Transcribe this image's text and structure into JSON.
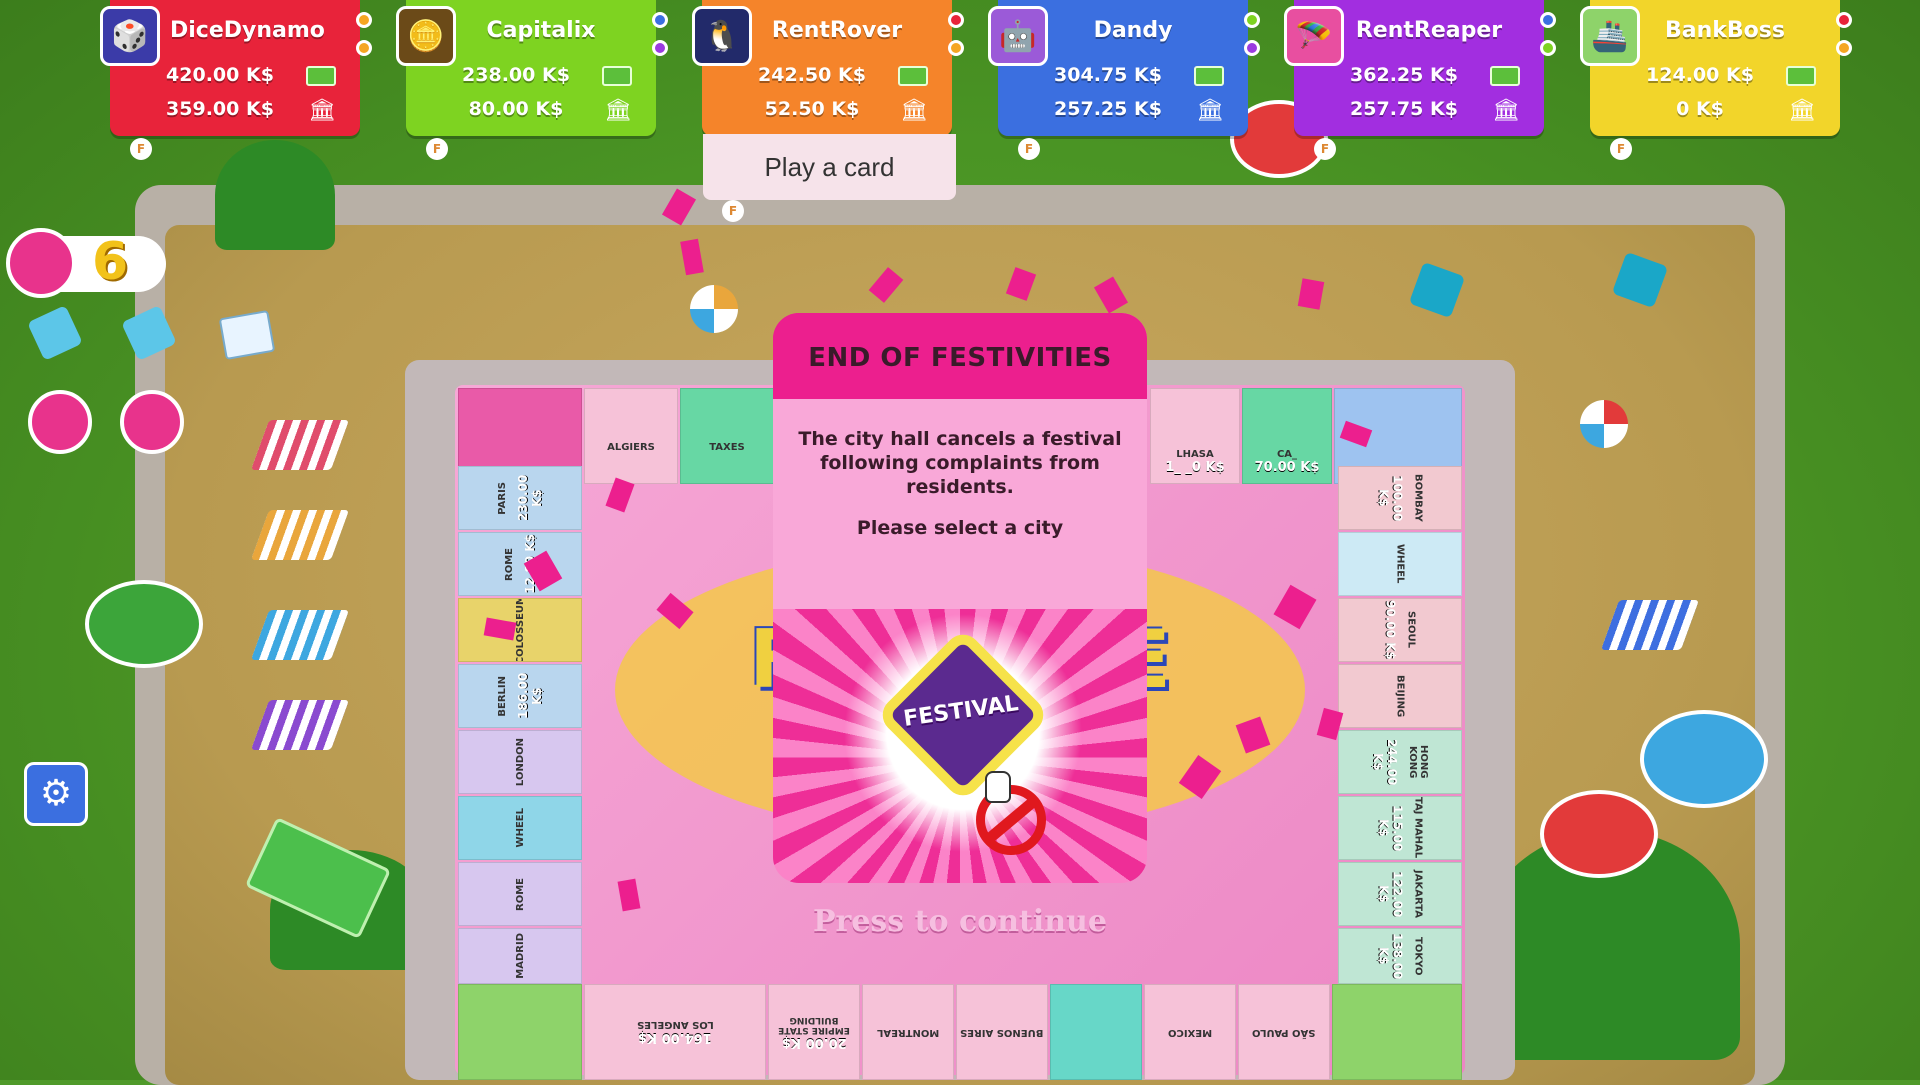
{
  "players": [
    {
      "name": "DiceDynamo",
      "cash": "420.00 K$",
      "bank": "359.00 K$",
      "color": "#e8233a",
      "avatar": "dice-avatar",
      "dots": [
        "#f5a623",
        "#f5a623"
      ]
    },
    {
      "name": "Capitalix",
      "cash": "238.00 K$",
      "bank": "80.00 K$",
      "color": "#7ed321",
      "avatar": "coins-avatar",
      "dots": [
        "#3b6fe0",
        "#9b3be0"
      ]
    },
    {
      "name": "RentRover",
      "cash": "242.50 K$",
      "bank": "52.50 K$",
      "color": "#f5842a",
      "avatar": "penguin-avatar",
      "dots": [
        "#e8233a",
        "#f5a623"
      ]
    },
    {
      "name": "Dandy",
      "cash": "304.75 K$",
      "bank": "257.25 K$",
      "color": "#3b6fe0",
      "avatar": "robot-avatar",
      "dots": [
        "#7ed321",
        "#9b3be0"
      ]
    },
    {
      "name": "RentReaper",
      "cash": "362.25 K$",
      "bank": "257.75 K$",
      "color": "#a22ee0",
      "avatar": "glider-avatar",
      "dots": [
        "#3b6fe0",
        "#7ed321"
      ]
    },
    {
      "name": "BankBoss",
      "cash": "124.00 K$",
      "bank": "0 K$",
      "color": "#f2d52a",
      "avatar": "ship-avatar",
      "dots": [
        "#e8233a",
        "#f5a623"
      ]
    }
  ],
  "play_card_label": "Play a card",
  "dice_count": "6",
  "card": {
    "title": "END OF FESTIVITIES",
    "description": "The city hall cancels a festival following complaints from residents.",
    "prompt": "Please select a city",
    "festival_label": "FESTIVAL"
  },
  "continue_label": "Press to continue",
  "board": {
    "top_tiles": [
      "ALGIERS",
      "TAXES"
    ],
    "left_tiles": [
      {
        "city": "PARIS",
        "price": "230.00 K$"
      },
      {
        "city": "ROME",
        "price": "12.80 K$"
      },
      {
        "city": "COLOSSEUM",
        "price": ""
      },
      {
        "city": "BERLIN",
        "price": "186.00 K$"
      },
      {
        "city": "LONDON",
        "price": ""
      },
      {
        "city": "WHEEL",
        "price": ""
      },
      {
        "city": "ROME",
        "price": ""
      },
      {
        "city": "MADRID",
        "price": ""
      }
    ],
    "right_tiles": [
      {
        "city": "BOMBAY",
        "price": "100.00 K$"
      },
      {
        "city": "WHEEL",
        "price": ""
      },
      {
        "city": "SEOUL",
        "price": "90.00 K$"
      },
      {
        "city": "BEIJING",
        "price": ""
      },
      {
        "city": "HONG KONG",
        "price": "244.00 K$"
      },
      {
        "city": "TAJ MAHAL",
        "price": "115.00 K$"
      },
      {
        "city": "JAKARTA",
        "price": "122.00 K$"
      },
      {
        "city": "TOKYO",
        "price": "138.00 K$"
      }
    ],
    "right_top": [
      {
        "city": "LHASA",
        "price": "1_ _0 K$"
      },
      {
        "city": "CA_",
        "price": "70.00 K$"
      }
    ],
    "bottom_tiles": [
      {
        "city": "LOS ANGELES",
        "price": "164.00 K$"
      },
      {
        "city": "EMPIRE STATE BUILDING",
        "price": "20.00 K$"
      },
      {
        "city": "MONTREAL",
        "price": ""
      },
      {
        "city": "BUENOS AIRES",
        "price": ""
      },
      {
        "city": "",
        "price": ""
      },
      {
        "city": "MEXICO",
        "price": ""
      },
      {
        "city": "SÃO PAULO",
        "price": ""
      }
    ]
  },
  "board_logo": "FORTUNE AVENUE"
}
